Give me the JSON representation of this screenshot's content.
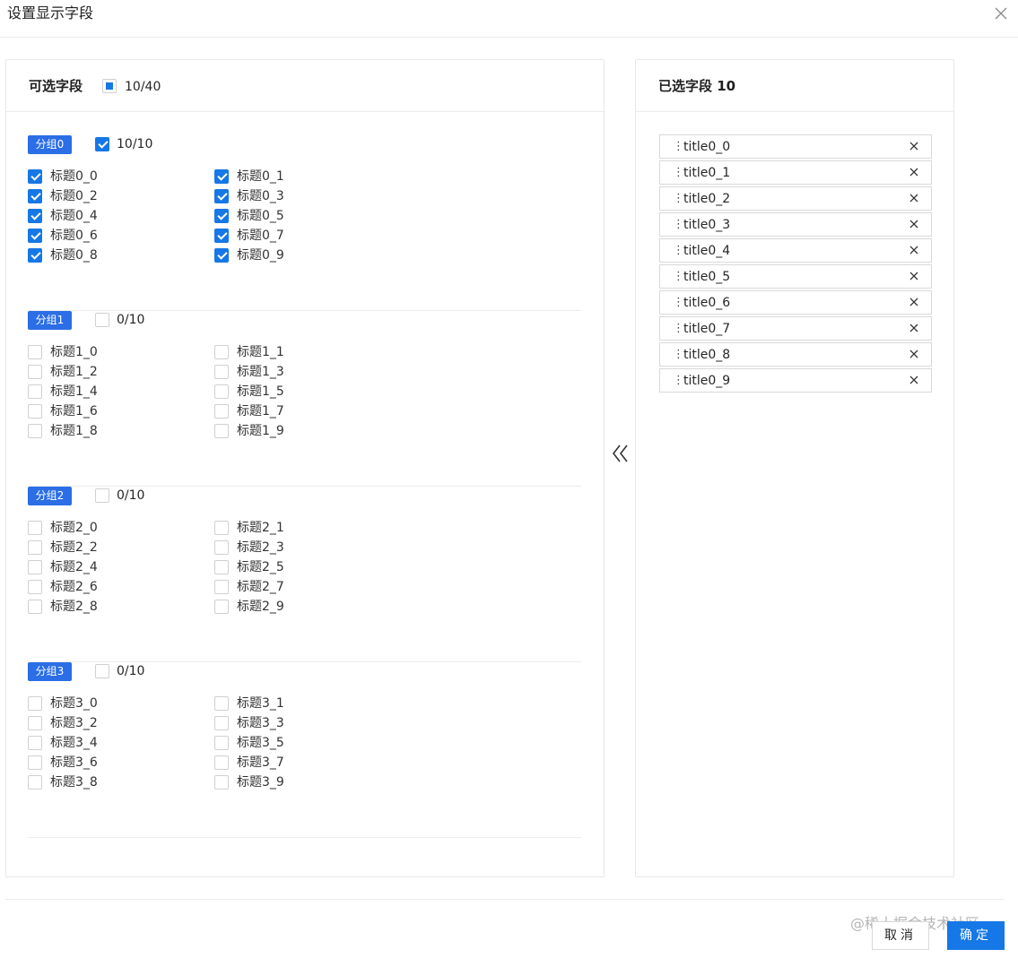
{
  "modal": {
    "title": "设置显示字段"
  },
  "available": {
    "title": "可选字段",
    "count": "10/40",
    "groups": [
      {
        "tag": "分组0",
        "count": "10/10",
        "checked": true,
        "items": [
          "标题0_0",
          "标题0_1",
          "标题0_2",
          "标题0_3",
          "标题0_4",
          "标题0_5",
          "标题0_6",
          "标题0_7",
          "标题0_8",
          "标题0_9"
        ]
      },
      {
        "tag": "分组1",
        "count": "0/10",
        "checked": false,
        "items": [
          "标题1_0",
          "标题1_1",
          "标题1_2",
          "标题1_3",
          "标题1_4",
          "标题1_5",
          "标题1_6",
          "标题1_7",
          "标题1_8",
          "标题1_9"
        ]
      },
      {
        "tag": "分组2",
        "count": "0/10",
        "checked": false,
        "items": [
          "标题2_0",
          "标题2_1",
          "标题2_2",
          "标题2_3",
          "标题2_4",
          "标题2_5",
          "标题2_6",
          "标题2_7",
          "标题2_8",
          "标题2_9"
        ]
      },
      {
        "tag": "分组3",
        "count": "0/10",
        "checked": false,
        "items": [
          "标题3_0",
          "标题3_1",
          "标题3_2",
          "标题3_3",
          "标题3_4",
          "标题3_5",
          "标题3_6",
          "标题3_7",
          "标题3_8",
          "标题3_9"
        ]
      }
    ]
  },
  "selected": {
    "title": "已选字段 10",
    "handle": "⋮",
    "items": [
      "title0_0",
      "title0_1",
      "title0_2",
      "title0_3",
      "title0_4",
      "title0_5",
      "title0_6",
      "title0_7",
      "title0_8",
      "title0_9"
    ]
  },
  "transfer": {
    "icon": "double-chevron-left-icon"
  },
  "footer": {
    "cancel_label": "取消",
    "ok_label": "确定"
  },
  "watermark": "@稀土掘金技术社区",
  "colors": {
    "primary": "#1677e6",
    "tag": "#2b6ee6",
    "border": "#e8e8e8"
  }
}
